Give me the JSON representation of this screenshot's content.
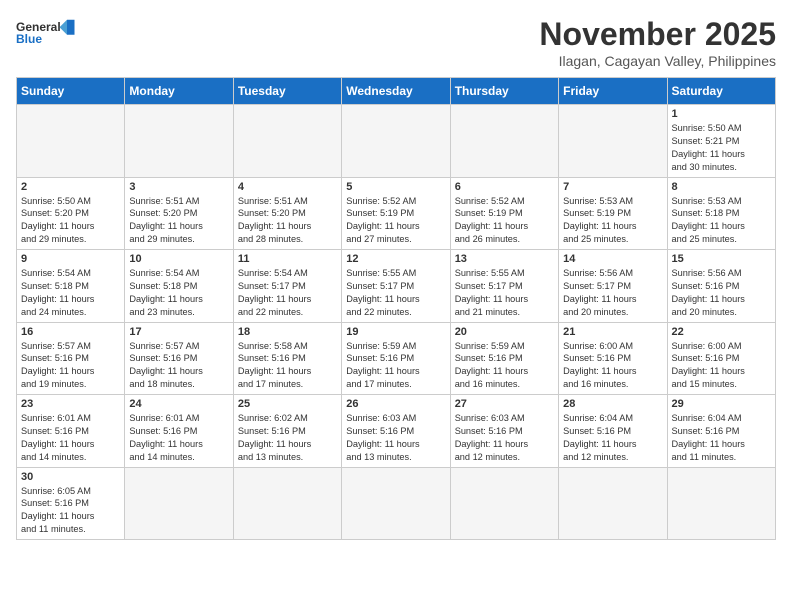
{
  "header": {
    "logo_general": "General",
    "logo_blue": "Blue",
    "month_title": "November 2025",
    "location": "Ilagan, Cagayan Valley, Philippines"
  },
  "days_of_week": [
    "Sunday",
    "Monday",
    "Tuesday",
    "Wednesday",
    "Thursday",
    "Friday",
    "Saturday"
  ],
  "weeks": [
    [
      {
        "day": "",
        "info": ""
      },
      {
        "day": "",
        "info": ""
      },
      {
        "day": "",
        "info": ""
      },
      {
        "day": "",
        "info": ""
      },
      {
        "day": "",
        "info": ""
      },
      {
        "day": "",
        "info": ""
      },
      {
        "day": "1",
        "info": "Sunrise: 5:50 AM\nSunset: 5:21 PM\nDaylight: 11 hours\nand 30 minutes."
      }
    ],
    [
      {
        "day": "2",
        "info": "Sunrise: 5:50 AM\nSunset: 5:20 PM\nDaylight: 11 hours\nand 29 minutes."
      },
      {
        "day": "3",
        "info": "Sunrise: 5:51 AM\nSunset: 5:20 PM\nDaylight: 11 hours\nand 29 minutes."
      },
      {
        "day": "4",
        "info": "Sunrise: 5:51 AM\nSunset: 5:20 PM\nDaylight: 11 hours\nand 28 minutes."
      },
      {
        "day": "5",
        "info": "Sunrise: 5:52 AM\nSunset: 5:19 PM\nDaylight: 11 hours\nand 27 minutes."
      },
      {
        "day": "6",
        "info": "Sunrise: 5:52 AM\nSunset: 5:19 PM\nDaylight: 11 hours\nand 26 minutes."
      },
      {
        "day": "7",
        "info": "Sunrise: 5:53 AM\nSunset: 5:19 PM\nDaylight: 11 hours\nand 25 minutes."
      },
      {
        "day": "8",
        "info": "Sunrise: 5:53 AM\nSunset: 5:18 PM\nDaylight: 11 hours\nand 25 minutes."
      }
    ],
    [
      {
        "day": "9",
        "info": "Sunrise: 5:54 AM\nSunset: 5:18 PM\nDaylight: 11 hours\nand 24 minutes."
      },
      {
        "day": "10",
        "info": "Sunrise: 5:54 AM\nSunset: 5:18 PM\nDaylight: 11 hours\nand 23 minutes."
      },
      {
        "day": "11",
        "info": "Sunrise: 5:54 AM\nSunset: 5:17 PM\nDaylight: 11 hours\nand 22 minutes."
      },
      {
        "day": "12",
        "info": "Sunrise: 5:55 AM\nSunset: 5:17 PM\nDaylight: 11 hours\nand 22 minutes."
      },
      {
        "day": "13",
        "info": "Sunrise: 5:55 AM\nSunset: 5:17 PM\nDaylight: 11 hours\nand 21 minutes."
      },
      {
        "day": "14",
        "info": "Sunrise: 5:56 AM\nSunset: 5:17 PM\nDaylight: 11 hours\nand 20 minutes."
      },
      {
        "day": "15",
        "info": "Sunrise: 5:56 AM\nSunset: 5:16 PM\nDaylight: 11 hours\nand 20 minutes."
      }
    ],
    [
      {
        "day": "16",
        "info": "Sunrise: 5:57 AM\nSunset: 5:16 PM\nDaylight: 11 hours\nand 19 minutes."
      },
      {
        "day": "17",
        "info": "Sunrise: 5:57 AM\nSunset: 5:16 PM\nDaylight: 11 hours\nand 18 minutes."
      },
      {
        "day": "18",
        "info": "Sunrise: 5:58 AM\nSunset: 5:16 PM\nDaylight: 11 hours\nand 17 minutes."
      },
      {
        "day": "19",
        "info": "Sunrise: 5:59 AM\nSunset: 5:16 PM\nDaylight: 11 hours\nand 17 minutes."
      },
      {
        "day": "20",
        "info": "Sunrise: 5:59 AM\nSunset: 5:16 PM\nDaylight: 11 hours\nand 16 minutes."
      },
      {
        "day": "21",
        "info": "Sunrise: 6:00 AM\nSunset: 5:16 PM\nDaylight: 11 hours\nand 16 minutes."
      },
      {
        "day": "22",
        "info": "Sunrise: 6:00 AM\nSunset: 5:16 PM\nDaylight: 11 hours\nand 15 minutes."
      }
    ],
    [
      {
        "day": "23",
        "info": "Sunrise: 6:01 AM\nSunset: 5:16 PM\nDaylight: 11 hours\nand 14 minutes."
      },
      {
        "day": "24",
        "info": "Sunrise: 6:01 AM\nSunset: 5:16 PM\nDaylight: 11 hours\nand 14 minutes."
      },
      {
        "day": "25",
        "info": "Sunrise: 6:02 AM\nSunset: 5:16 PM\nDaylight: 11 hours\nand 13 minutes."
      },
      {
        "day": "26",
        "info": "Sunrise: 6:03 AM\nSunset: 5:16 PM\nDaylight: 11 hours\nand 13 minutes."
      },
      {
        "day": "27",
        "info": "Sunrise: 6:03 AM\nSunset: 5:16 PM\nDaylight: 11 hours\nand 12 minutes."
      },
      {
        "day": "28",
        "info": "Sunrise: 6:04 AM\nSunset: 5:16 PM\nDaylight: 11 hours\nand 12 minutes."
      },
      {
        "day": "29",
        "info": "Sunrise: 6:04 AM\nSunset: 5:16 PM\nDaylight: 11 hours\nand 11 minutes."
      }
    ],
    [
      {
        "day": "30",
        "info": "Sunrise: 6:05 AM\nSunset: 5:16 PM\nDaylight: 11 hours\nand 11 minutes."
      },
      {
        "day": "",
        "info": ""
      },
      {
        "day": "",
        "info": ""
      },
      {
        "day": "",
        "info": ""
      },
      {
        "day": "",
        "info": ""
      },
      {
        "day": "",
        "info": ""
      },
      {
        "day": "",
        "info": ""
      }
    ]
  ]
}
